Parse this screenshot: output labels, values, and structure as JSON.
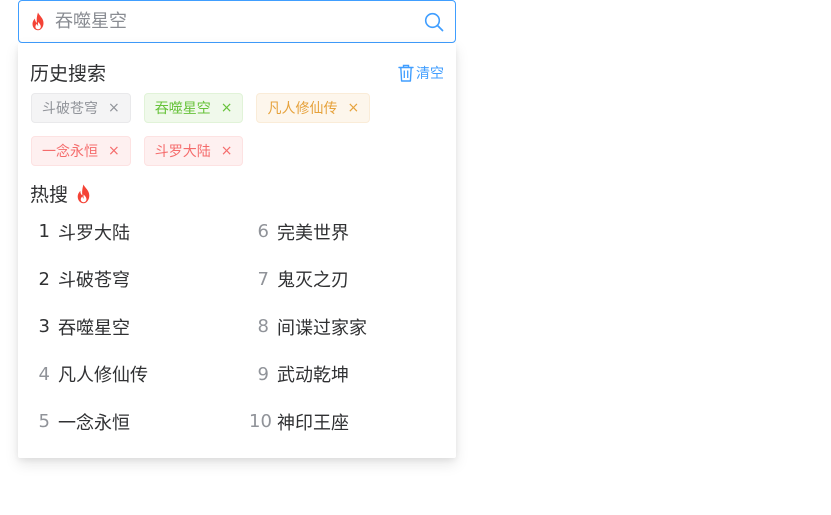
{
  "search": {
    "placeholder": "吞噬星空",
    "value": ""
  },
  "history": {
    "title": "历史搜索",
    "clear_label": "清空",
    "tags": [
      {
        "label": "斗破苍穹",
        "type": "gray"
      },
      {
        "label": "吞噬星空",
        "type": "green"
      },
      {
        "label": "凡人修仙传",
        "type": "orange"
      },
      {
        "label": "一念永恒",
        "type": "red"
      },
      {
        "label": "斗罗大陆",
        "type": "red"
      }
    ],
    "close_glyph": "×"
  },
  "hot": {
    "title": "热搜",
    "items": [
      {
        "rank": "1",
        "label": "斗罗大陆"
      },
      {
        "rank": "6",
        "label": "完美世界"
      },
      {
        "rank": "2",
        "label": "斗破苍穹"
      },
      {
        "rank": "7",
        "label": "鬼灭之刃"
      },
      {
        "rank": "3",
        "label": "吞噬星空"
      },
      {
        "rank": "8",
        "label": "间谍过家家"
      },
      {
        "rank": "4",
        "label": "凡人修仙传"
      },
      {
        "rank": "9",
        "label": "武动乾坤"
      },
      {
        "rank": "5",
        "label": "一念永恒"
      },
      {
        "rank": "10",
        "label": "神印王座"
      }
    ]
  },
  "colors": {
    "accent": "#409eff",
    "fire": "#f44336",
    "text": "#303133",
    "muted": "#909399"
  },
  "icons": {
    "fire": "fire-icon",
    "search": "search-icon",
    "trash": "trash-icon",
    "close": "close-icon"
  }
}
